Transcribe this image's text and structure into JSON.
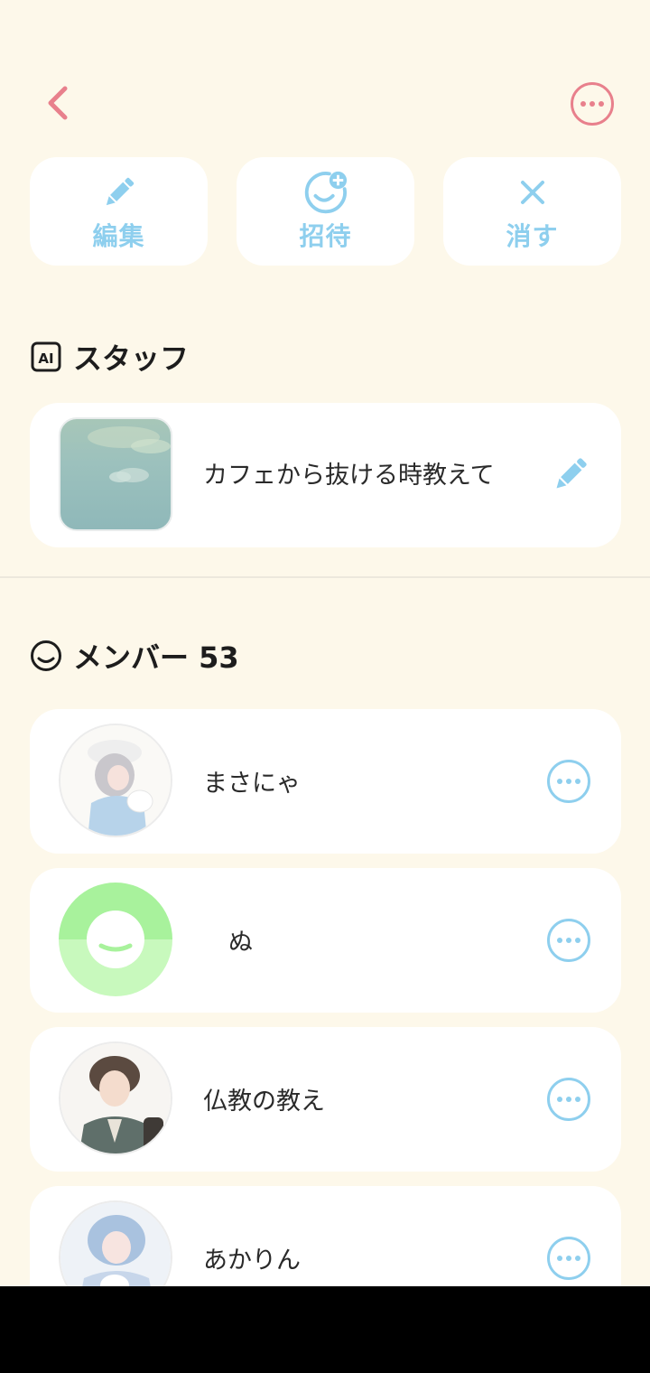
{
  "nav": {
    "back_icon": "chevron-left-icon",
    "more_icon": "more-horizontal-circle-icon",
    "accent_color": "#e8808c"
  },
  "actions": [
    {
      "label": "編集",
      "icon": "pencil-icon"
    },
    {
      "label": "招待",
      "icon": "smiley-plus-icon"
    },
    {
      "label": "消す",
      "icon": "close-icon"
    }
  ],
  "staff_section": {
    "title": "スタッフ",
    "icon": "ai-badge-icon",
    "item": {
      "text": "カフェから抜ける時教えて",
      "edit_icon": "pencil-icon"
    }
  },
  "members_section": {
    "title": "メンバー 53",
    "icon": "smiley-outline-icon",
    "members": [
      {
        "name": "まさにゃ",
        "avatar": "anime-girl-beret-avatar"
      },
      {
        "name": "ぬ",
        "avatar": "default-smiley-avatar"
      },
      {
        "name": "仏教の教え",
        "avatar": "anime-boy-avatar"
      },
      {
        "name": "あかりん",
        "avatar": "anime-girl-blue-hair-avatar"
      }
    ]
  },
  "colors": {
    "background": "#fdf8ea",
    "card": "#ffffff",
    "blue_accent": "#8ecfee",
    "pink_accent": "#e8808c",
    "green_avatar": "#a8f29c"
  }
}
